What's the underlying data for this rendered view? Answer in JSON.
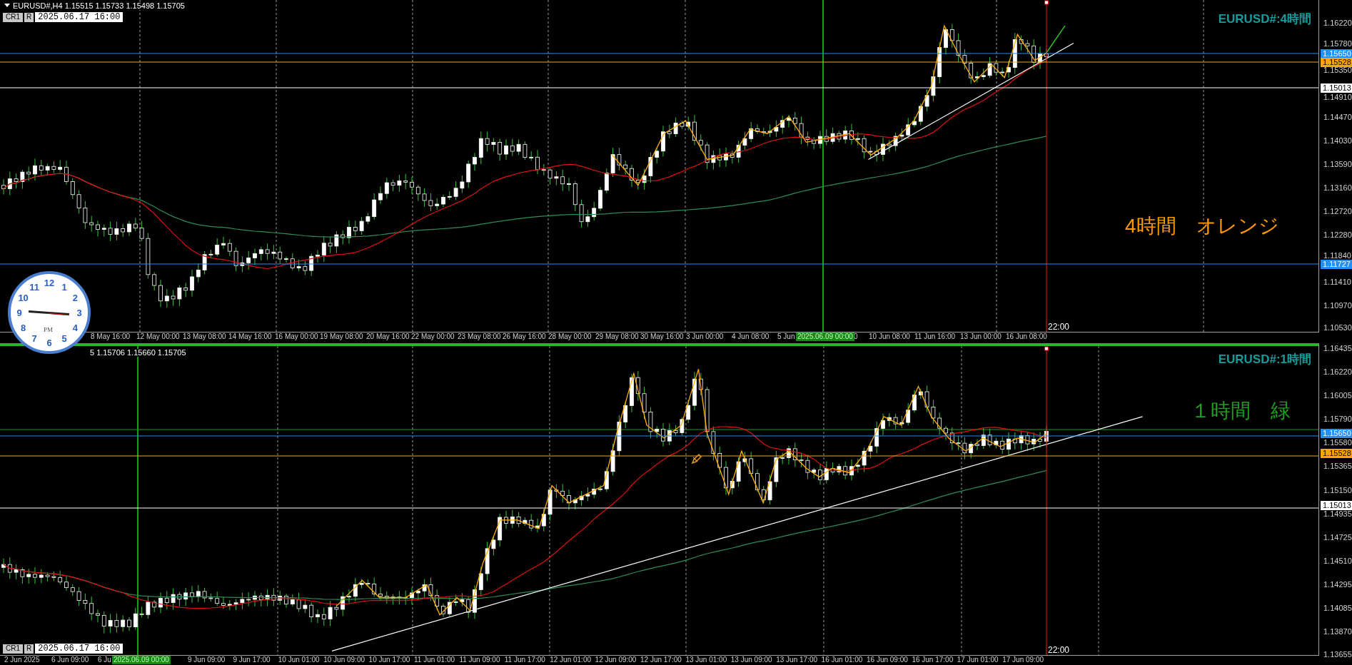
{
  "panes": [
    {
      "kind": "upper",
      "header": "EURUSD#,H4  1.15515 1.15733 1.15498 1.15705",
      "cr_button": "CR1",
      "r_button": "R",
      "cursor_time": "2025.06.17 16:00",
      "symbol_label": "EURUSD#:4時間",
      "note": "4時間　オレンジ",
      "end_time": "22:00",
      "price_ticks": [
        "1.16220",
        "1.15780",
        "1.15350",
        "1.14910",
        "1.14470",
        "1.14030",
        "1.13590",
        "1.13160",
        "1.12720",
        "1.12280",
        "1.11840",
        "1.11410",
        "1.10970",
        "1.10530"
      ],
      "price_markers": [
        {
          "text": "1.15650",
          "color": "#1e90ff"
        },
        {
          "text": "1.15528",
          "color": "#ffa500"
        },
        {
          "text": "1.15013",
          "color": "#ffffff"
        },
        {
          "text": "1.11727",
          "color": "#1e90ff"
        }
      ],
      "time_labels": [
        "8 May 16:00",
        "12 May 00:00",
        "13 May 08:00",
        "14 May 16:00",
        "16 May 00:00",
        "19 May 08:00",
        "20 May 16:00",
        "22 May 00:00",
        "23 May 08:00",
        "26 May 16:00",
        "28 May 00:00",
        "29 May 08:00",
        "30 May 16:00",
        "3 Jun 00:00",
        "4 Jun 08:00",
        "5 Jun",
        "0",
        "10 Jun 08:00",
        "11 Jun 16:00",
        "13 Jun 00:00",
        "16 Jun 08:00"
      ],
      "cursor_label": "2025.06.09 00:00"
    },
    {
      "kind": "lower",
      "header": "5 1.15706 1.15660 1.15705",
      "cr_button": "CR1",
      "r_button": "R",
      "cursor_time": "2025.06.17 16:00",
      "symbol_label": "EURUSD#:1時間",
      "note": "１時間　緑",
      "end_time": "22:00",
      "price_ticks": [
        "1.16435",
        "1.16220",
        "1.16005",
        "1.15790",
        "1.15580",
        "1.15365",
        "1.15150",
        "1.14935",
        "1.14725",
        "1.14510",
        "1.14295",
        "1.14085",
        "1.13870",
        "1.13655"
      ],
      "price_markers": [
        {
          "text": "1.15650",
          "color": "#1e90ff"
        },
        {
          "text": "1.15528",
          "color": "#ffa500"
        },
        {
          "text": "1.15013",
          "color": "#ffffff"
        }
      ],
      "time_labels": [
        "2 Jun 2025",
        "6 Jun 09:00",
        "6 Ju",
        "9 Jun 09:00",
        "9 Jun 17:00",
        "10 Jun 01:00",
        "10 Jun 09:00",
        "10 Jun 17:00",
        "11 Jun 01:00",
        "11 Jun 09:00",
        "11 Jun 17:00",
        "12 Jun 01:00",
        "12 Jun 09:00",
        "12 Jun 17:00",
        "13 Jun 01:00",
        "13 Jun 09:00",
        "13 Jun 17:00",
        "16 Jun 01:00",
        "16 Jun 09:00",
        "16 Jun 17:00",
        "17 Jun 01:00",
        "17 Jun 09:00"
      ],
      "cursor_label": "2025.06.09 00:00"
    }
  ],
  "clock": {
    "numbers": [
      "12",
      "11",
      "1",
      "10",
      "2",
      "9",
      "3",
      "8",
      "4",
      "7",
      "5",
      "6"
    ],
    "period": "PM"
  }
}
